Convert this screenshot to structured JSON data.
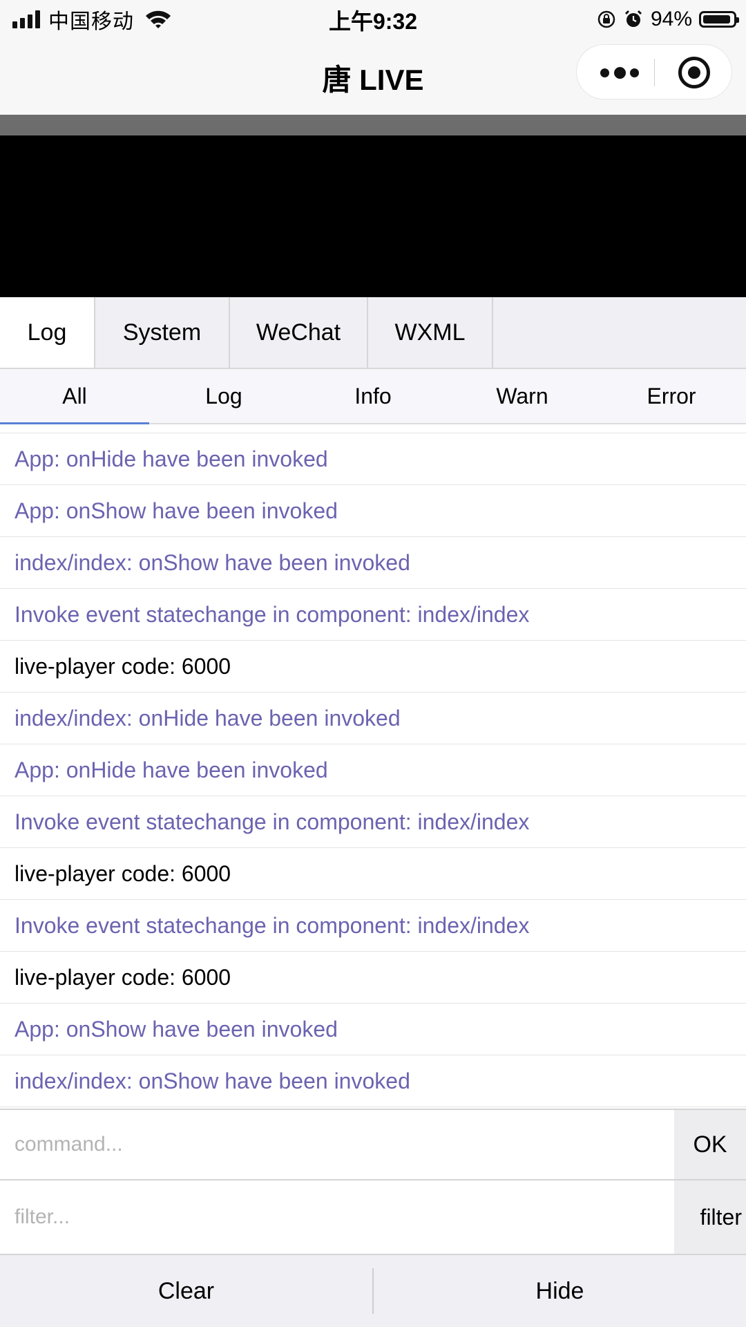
{
  "status_bar": {
    "carrier": "中国移动",
    "time": "上午9:32",
    "battery_percent": "94%",
    "battery_level": 0.94,
    "icons": [
      "signal-icon",
      "wifi-icon",
      "rotation-lock-icon",
      "alarm-icon",
      "battery-icon"
    ]
  },
  "nav": {
    "title": "唐 LIVE",
    "icons": [
      "more-icon",
      "close-target-icon"
    ]
  },
  "main_tabs": [
    {
      "label": "Log",
      "active": true
    },
    {
      "label": "System",
      "active": false
    },
    {
      "label": "WeChat",
      "active": false
    },
    {
      "label": "WXML",
      "active": false
    }
  ],
  "sub_tabs": [
    {
      "label": "All",
      "active": true
    },
    {
      "label": "Log",
      "active": false
    },
    {
      "label": "Info",
      "active": false
    },
    {
      "label": "Warn",
      "active": false
    },
    {
      "label": "Error",
      "active": false
    }
  ],
  "logs": [
    {
      "text": "App: onHide have been invoked",
      "kind": "sys"
    },
    {
      "text": "App: onShow have been invoked",
      "kind": "sys"
    },
    {
      "text": "index/index: onShow have been invoked",
      "kind": "sys"
    },
    {
      "text": "Invoke event statechange in component: index/index",
      "kind": "sys"
    },
    {
      "text": "live-player code: 6000",
      "kind": "plain"
    },
    {
      "text": "index/index: onHide have been invoked",
      "kind": "sys"
    },
    {
      "text": "App: onHide have been invoked",
      "kind": "sys"
    },
    {
      "text": "Invoke event statechange in component: index/index",
      "kind": "sys"
    },
    {
      "text": "live-player code: 6000",
      "kind": "plain"
    },
    {
      "text": "Invoke event statechange in component: index/index",
      "kind": "sys"
    },
    {
      "text": "live-player code: 6000",
      "kind": "plain"
    },
    {
      "text": "App: onShow have been invoked",
      "kind": "sys"
    },
    {
      "text": "index/index: onShow have been invoked",
      "kind": "sys"
    }
  ],
  "command": {
    "placeholder": "command...",
    "button": "OK"
  },
  "filter": {
    "placeholder": "filter...",
    "button": "filter"
  },
  "bottom": {
    "clear": "Clear",
    "hide": "Hide"
  },
  "colors": {
    "log_system": "#6b63b0",
    "active_underline": "#5b7fd6"
  }
}
